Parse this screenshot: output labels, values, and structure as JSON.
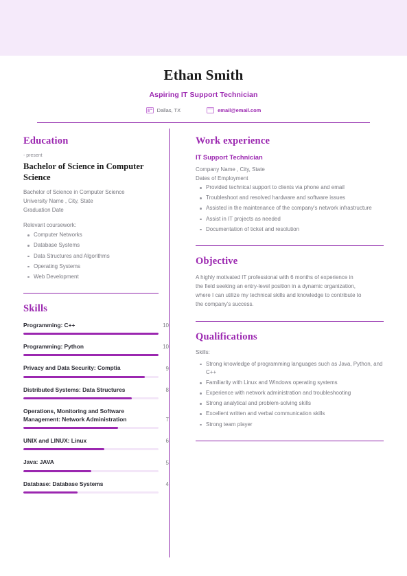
{
  "header": {
    "name": "Ethan Smith",
    "title": "Aspiring IT Support Technician",
    "location": "Dallas, TX",
    "email": "email@email.com",
    "location_icon": "location-card-icon",
    "email_icon": "envelope-icon"
  },
  "theme": {
    "accent": "#9b27b0",
    "rule": "#8e24aa",
    "banner": "#f5eafa",
    "track": "#f3e6f8",
    "muted_text": "#77777f"
  },
  "left": {
    "education": {
      "heading": "Education",
      "date": "- present",
      "degree": "Bachelor of Science in Computer Science",
      "lines": [
        "Bachelor of Science in Computer Science",
        "University Name , City, State",
        "Graduation Date"
      ],
      "coursework_label": "Relevant coursework:",
      "coursework": [
        "Computer Networks",
        "Database Systems",
        "Data Structures and Algorithms",
        "Operating Systems",
        "Web Development"
      ]
    },
    "skills": {
      "heading": "Skills",
      "max": 10,
      "items": [
        {
          "name": "Programming: C++",
          "score": 10
        },
        {
          "name": "Programming: Python",
          "score": 10
        },
        {
          "name": "Privacy and Data Security: Comptia",
          "score": 9
        },
        {
          "name": "Distributed Systems: Data Structures",
          "score": 8
        },
        {
          "name": "Operations, Monitoring and Software Management: Network Administration",
          "score": 7
        },
        {
          "name": "UNIX and LINUX: Linux",
          "score": 6
        },
        {
          "name": "Java: JAVA",
          "score": 5
        },
        {
          "name": "Database: Database Systems",
          "score": 4
        }
      ]
    }
  },
  "right": {
    "work": {
      "heading": "Work experience",
      "job_title": "IT Support Technician",
      "company": "Company Name , City, State",
      "dates": "Dates of Employment",
      "bullets": [
        "Provided technical support to clients via phone and email",
        "Troubleshoot and resolved hardware and software issues",
        "Assisted in the maintenance of the company's network infrastructure",
        "Assist in IT projects as needed",
        "Documentation of ticket and resolution"
      ]
    },
    "objective": {
      "heading": "Objective",
      "text": "A highly motivated IT professional with 6 months of experience in the field seeking an entry-level position in a dynamic organization, where I can utilize my technical skills and knowledge to contribute to the company's success."
    },
    "qualifications": {
      "heading": "Qualifications",
      "label": "Skills:",
      "bullets": [
        "Strong knowledge of programming languages such as Java, Python, and C++",
        "Familiarity with Linux and Windows operating systems",
        "Experience with network administration and troubleshooting",
        "Strong analytical and problem-solving skills",
        "Excellent written and verbal communication skills",
        "Strong team player"
      ]
    }
  }
}
